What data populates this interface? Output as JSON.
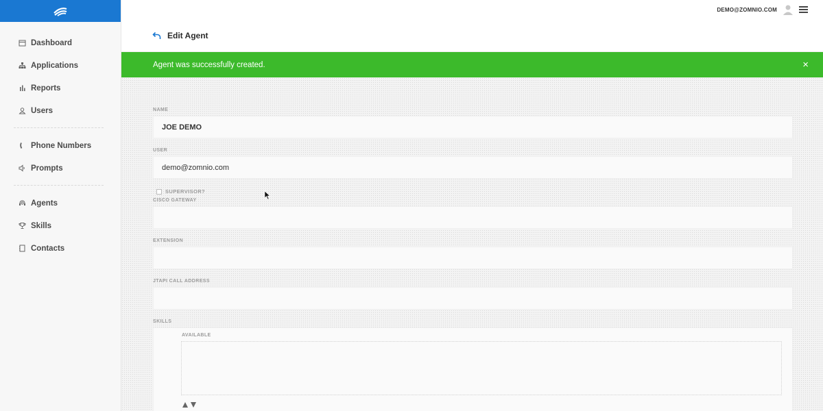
{
  "topbar": {
    "user_email": "DEMO@ZOMNIO.COM"
  },
  "sidebar": {
    "items": [
      {
        "label": "Dashboard",
        "icon": "calendar-icon"
      },
      {
        "label": "Applications",
        "icon": "sitemap-icon"
      },
      {
        "label": "Reports",
        "icon": "bar-chart-icon"
      },
      {
        "label": "Users",
        "icon": "user-icon"
      },
      {
        "label": "Phone Numbers",
        "icon": "phone-icon"
      },
      {
        "label": "Prompts",
        "icon": "speaker-icon"
      },
      {
        "label": "Agents",
        "icon": "headset-icon"
      },
      {
        "label": "Skills",
        "icon": "trophy-icon"
      },
      {
        "label": "Contacts",
        "icon": "address-book-icon"
      }
    ]
  },
  "header": {
    "title": "Edit Agent"
  },
  "alert": {
    "message": "Agent was successfully created.",
    "close": "×",
    "color": "#3cba2b"
  },
  "form": {
    "name": {
      "label": "NAME",
      "value": "JOE DEMO"
    },
    "user": {
      "label": "USER",
      "value": "demo@zomnio.com"
    },
    "supervisor": {
      "label": "SUPERVISOR?",
      "checked": false
    },
    "cisco_gateway": {
      "label": "CISCO GATEWAY",
      "value": ""
    },
    "extension": {
      "label": "EXTENSION",
      "value": ""
    },
    "jtapi": {
      "label": "JTAPI CALL ADDRESS",
      "value": ""
    },
    "skills": {
      "label": "SKILLS",
      "available_label": "AVAILABLE"
    }
  },
  "colors": {
    "brand": "#1a78d2",
    "success": "#3cba2b"
  }
}
